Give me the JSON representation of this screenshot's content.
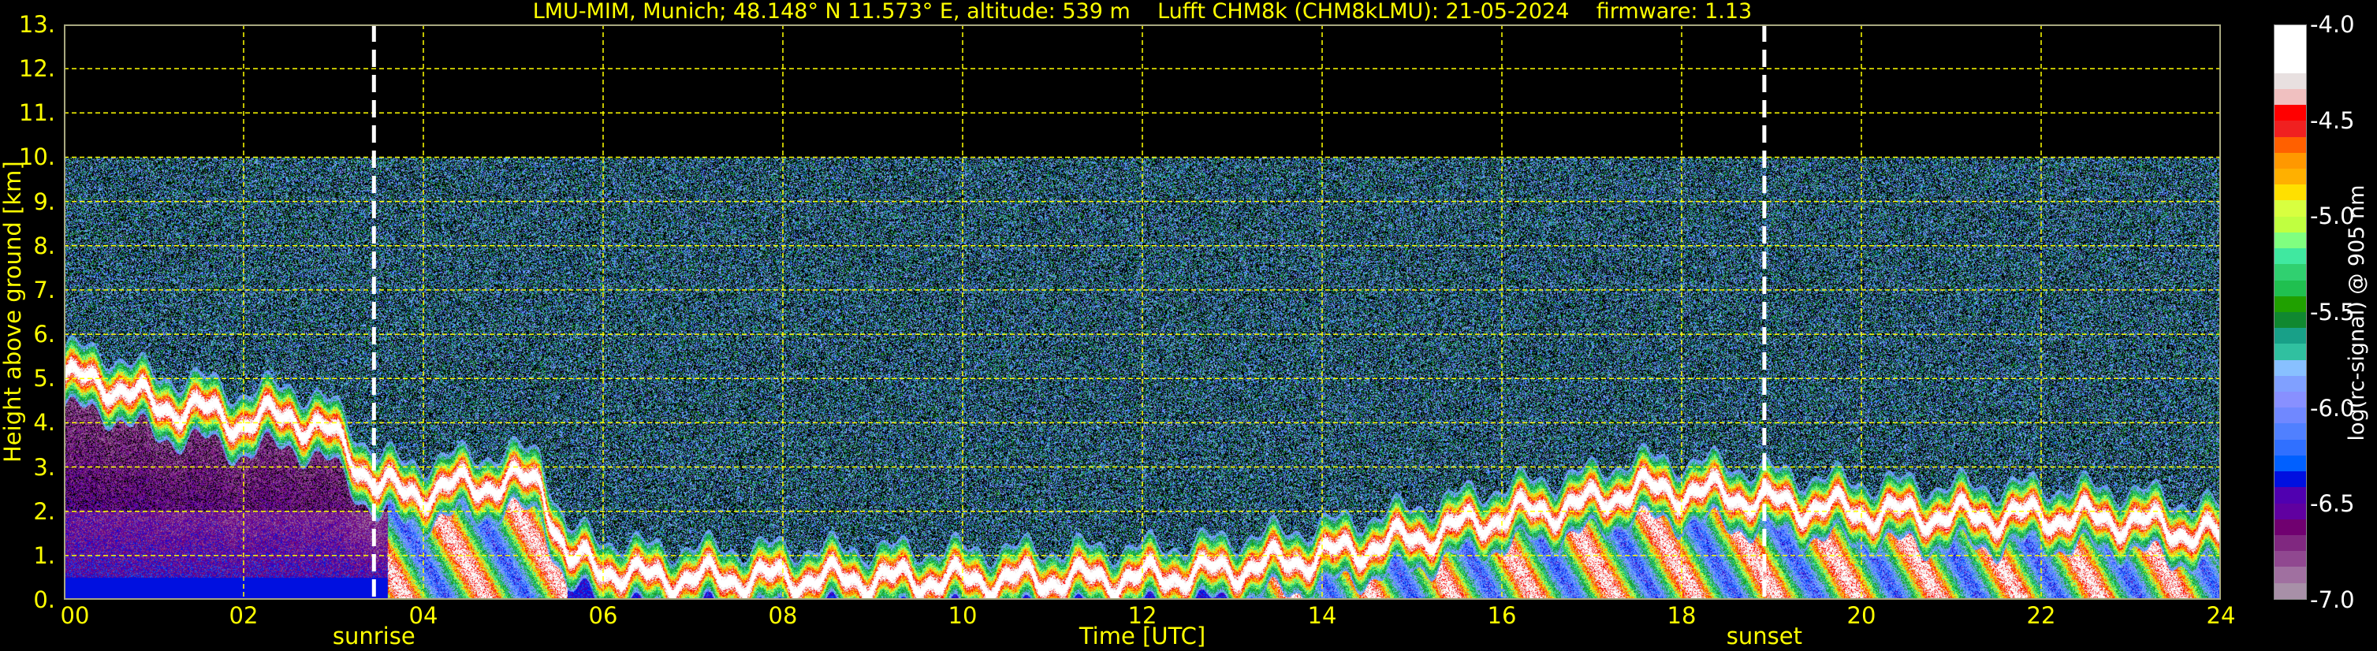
{
  "chart_data": {
    "type": "heatmap",
    "title": "LMU-MIM, Munich; 48.148° N 11.573° E, altitude: 539 m    Lufft CHM8k (CHM8kLMU): 21-05-2024    firmware: 1.13",
    "xlabel": "Time [UTC]",
    "ylabel": "Height above ground [km]",
    "xlim": [
      0,
      24
    ],
    "ylim": [
      0,
      13
    ],
    "xticks": [
      "00",
      "02",
      "04",
      "06",
      "08",
      "10",
      "12",
      "14",
      "16",
      "18",
      "20",
      "22",
      "24"
    ],
    "yticks": [
      "0.",
      "1.",
      "2.",
      "3.",
      "4.",
      "5.",
      "6.",
      "7.",
      "8.",
      "9.",
      "10.",
      "11.",
      "12.",
      "13."
    ],
    "grid": true,
    "data_top_km": 10,
    "events": [
      {
        "label": "sunrise",
        "time_h": 3.45
      },
      {
        "label": "sunset",
        "time_h": 18.92
      }
    ],
    "colorbar": {
      "label": "log(rc-signal) @ 905 nm",
      "range": [
        -7.0,
        -4.0
      ],
      "ticks": [
        "-4.0",
        "-4.5",
        "-5.0",
        "-5.5",
        "-6.0",
        "-6.5",
        "-7.0"
      ],
      "colors": [
        "#a890a8",
        "#a070a0",
        "#904890",
        "#802880",
        "#700070",
        "#6000a0",
        "#5000b0",
        "#0010e0",
        "#0060ff",
        "#3070ff",
        "#5080ff",
        "#7088ff",
        "#8890ff",
        "#80a0ff",
        "#88c0ff",
        "#30c0a0",
        "#18a088",
        "#108830",
        "#20a000",
        "#20c050",
        "#30d070",
        "#40e8a0",
        "#80ff80",
        "#c0ff40",
        "#d8ff40",
        "#ffe000",
        "#ffb000",
        "#ff9800",
        "#ff6000",
        "#f02020",
        "#ff0000",
        "#f0c0c0",
        "#e8e0e0",
        "#ffffff",
        "#ffffff",
        "#ffffff"
      ]
    },
    "layer_top_km": {
      "time_h": [
        0,
        0.5,
        1,
        1.5,
        2,
        2.5,
        3,
        3.5,
        3.8,
        4.5,
        5.3,
        5.6,
        6.5,
        8,
        10,
        12,
        13,
        14,
        15,
        16,
        17,
        17.4,
        17.6,
        18.5,
        19,
        20,
        21,
        22,
        23,
        24
      ],
      "height_km": [
        5.0,
        4.9,
        4.4,
        4.3,
        4.0,
        4.2,
        3.7,
        2.6,
        2.4,
        2.6,
        2.7,
        0.9,
        0.5,
        0.5,
        0.45,
        0.5,
        0.7,
        1.0,
        1.4,
        1.9,
        2.2,
        2.5,
        2.5,
        2.4,
        2.2,
        2.0,
        1.9,
        1.9,
        1.8,
        1.4
      ]
    }
  }
}
